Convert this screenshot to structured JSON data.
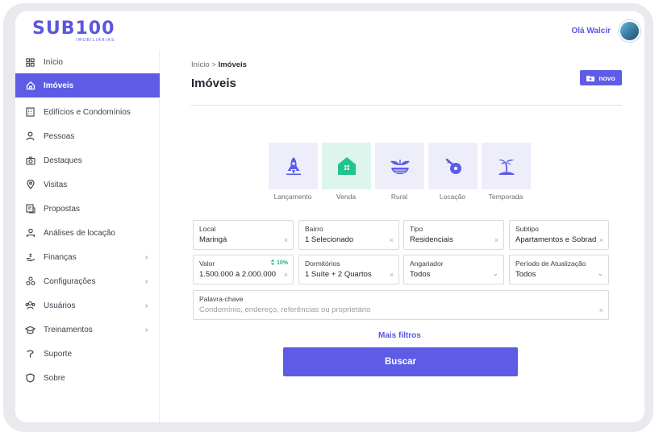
{
  "header": {
    "logo_text": "SUB100",
    "logo_sub": "IMOBILIÁRIAS",
    "greeting": "Olá Walcir"
  },
  "sidebar": {
    "items": [
      {
        "label": "Início",
        "icon": "grid-icon",
        "chevron": false,
        "active": false
      },
      {
        "label": "Imóveis",
        "icon": "home-icon",
        "chevron": false,
        "active": true
      },
      {
        "label": "Edifícios e Condomínios",
        "icon": "building-icon",
        "chevron": false,
        "active": false
      },
      {
        "label": "Pessoas",
        "icon": "person-icon",
        "chevron": false,
        "active": false
      },
      {
        "label": "Destaques",
        "icon": "camera-icon",
        "chevron": false,
        "active": false
      },
      {
        "label": "Visitas",
        "icon": "map-pin-icon",
        "chevron": false,
        "active": false
      },
      {
        "label": "Propostas",
        "icon": "proposal-icon",
        "chevron": false,
        "active": false
      },
      {
        "label": "Análises de locação",
        "icon": "people-icon",
        "chevron": false,
        "active": false
      },
      {
        "label": "Finanças",
        "icon": "finance-icon",
        "chevron": true,
        "active": false
      },
      {
        "label": "Configurações",
        "icon": "settings-icon",
        "chevron": true,
        "active": false
      },
      {
        "label": "Usuários",
        "icon": "users-icon",
        "chevron": true,
        "active": false
      },
      {
        "label": "Treinamentos",
        "icon": "graduation-cap-icon",
        "chevron": true,
        "active": false
      },
      {
        "label": "Suporte",
        "icon": "support-icon",
        "chevron": false,
        "active": false
      },
      {
        "label": "Sobre",
        "icon": "shield-icon",
        "chevron": false,
        "active": false
      }
    ],
    "chevron_glyph": "›"
  },
  "main": {
    "breadcrumb_root": "Início",
    "breadcrumb_sep": ">",
    "breadcrumb_current": "Imóveis",
    "title": "Imóveis",
    "new_button": "novo",
    "types": [
      {
        "label": "Lançamento",
        "icon": "rocket-icon",
        "selected": false
      },
      {
        "label": "Venda",
        "icon": "house-icon",
        "selected": true
      },
      {
        "label": "Rural",
        "icon": "rural-icon",
        "selected": false
      },
      {
        "label": "Locação",
        "icon": "key-icon",
        "selected": false
      },
      {
        "label": "Temporada",
        "icon": "palm-tree-icon",
        "selected": false
      }
    ],
    "filters": {
      "local": {
        "label": "Local",
        "value": "Maringá"
      },
      "bairro": {
        "label": "Bairro",
        "value": "1 Selecionado"
      },
      "tipo": {
        "label": "Tipo",
        "value": "Residenciais"
      },
      "subtipo": {
        "label": "Subtipo",
        "value": "Apartamentos e Sobrados"
      },
      "valor": {
        "label": "Valor",
        "value": "1.500.000 à 2.000.000",
        "badge": "10%"
      },
      "dormitorios": {
        "label": "Dormitórios",
        "value": "1 Suíte + 2 Quartos"
      },
      "angariador": {
        "label": "Angariador",
        "value": "Todos"
      },
      "periodo": {
        "label": "Período de Atualização",
        "value": "Todos"
      },
      "palavra": {
        "label": "Palavra-chave",
        "placeholder": "Condomínio, endereço, referências ou proprietário"
      }
    },
    "clear_glyph": "×",
    "dropdown_glyph": "⌄",
    "more_filters": "Mais filtros",
    "search_button": "Buscar"
  },
  "colors": {
    "accent": "#5e5ce6",
    "selected_card": "#ddf5ed",
    "card": "#eeeefb",
    "success": "#1fb487"
  }
}
